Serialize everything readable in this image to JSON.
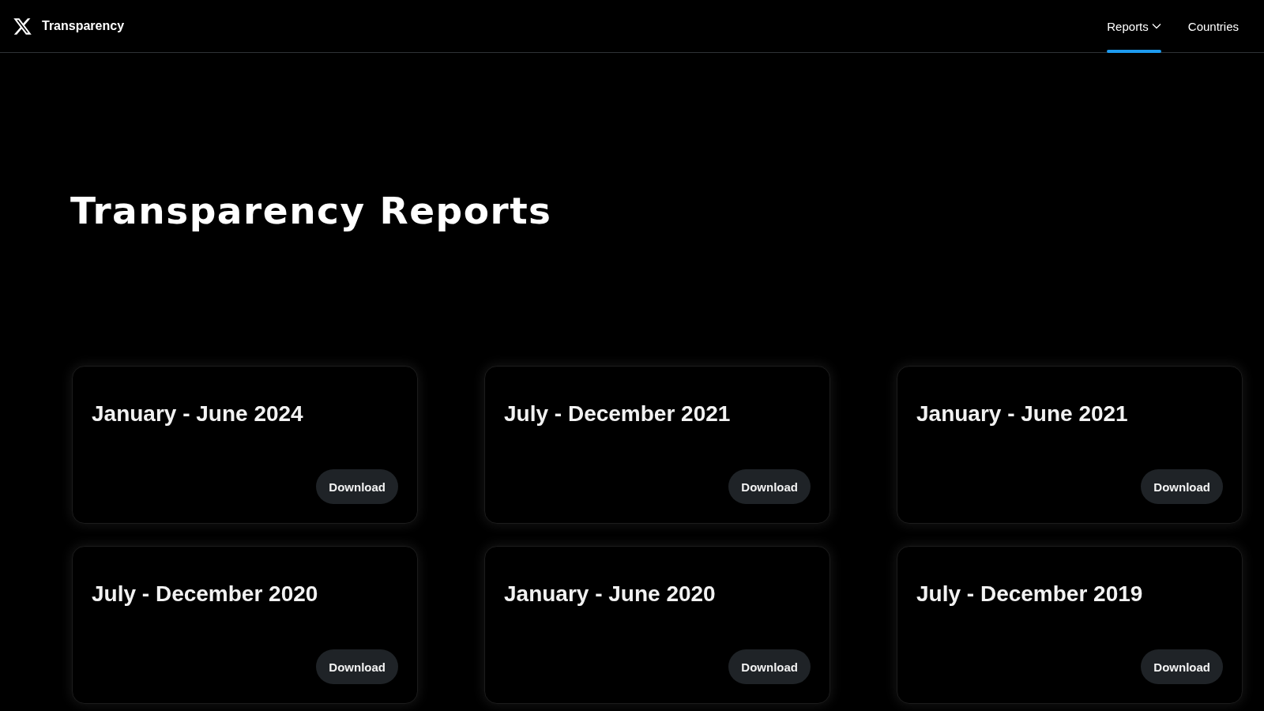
{
  "header": {
    "site_title": "Transparency",
    "nav": [
      {
        "label": "Reports",
        "kind": "dropdown",
        "selected": true
      },
      {
        "label": "Countries",
        "kind": "link",
        "selected": false
      }
    ]
  },
  "page_title": "Transparency Reports",
  "reports": [
    {
      "period": "January - June 2024",
      "button": "Download"
    },
    {
      "period": "July - December 2021",
      "button": "Download"
    },
    {
      "period": "January - June 2021",
      "button": "Download"
    },
    {
      "period": "July - December 2020",
      "button": "Download"
    },
    {
      "period": "January - June 2020",
      "button": "Download"
    },
    {
      "period": "July - December 2019",
      "button": "Download"
    }
  ]
}
